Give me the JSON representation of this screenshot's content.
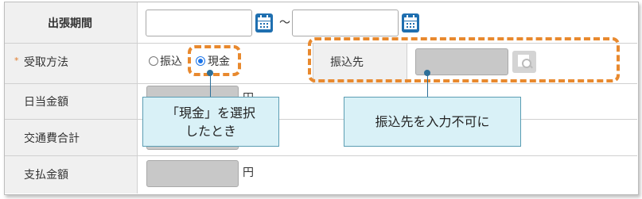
{
  "rows": {
    "trip_period": {
      "label": "出張期間",
      "range_separator": "〜"
    },
    "receive_method": {
      "required_mark": "*",
      "label": "受取方法",
      "option_transfer": "振込",
      "option_cash": "現金",
      "selected": "現金",
      "transfer_dest_label": "振込先"
    },
    "daily_allowance": {
      "label": "日当金額",
      "unit": "円"
    },
    "transport_total": {
      "label": "交通費合計"
    },
    "payment_amount": {
      "label": "支払金額",
      "unit": "円"
    }
  },
  "callouts": {
    "cash_selected_line1": "「現金」を選択",
    "cash_selected_line2": "したとき",
    "transfer_disabled": "振込先を入力不可に"
  },
  "colors": {
    "accent_orange": "#e8892e",
    "calendar_blue": "#1f6fb0",
    "callout_bg": "#d9f1f7"
  }
}
